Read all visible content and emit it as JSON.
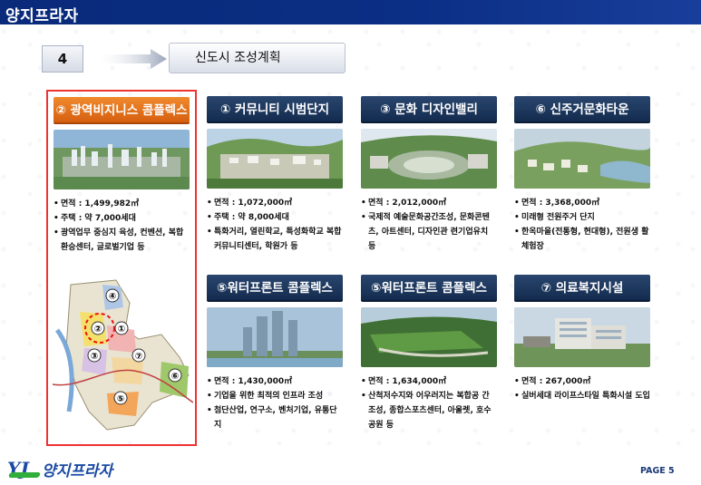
{
  "header": {
    "title": "양지프라자"
  },
  "section": {
    "number": "4",
    "title": "신도시 조성계획"
  },
  "featured": {
    "title": "② 광역비지니스 콤플렉스",
    "bullets": [
      "면적 : 1,499,982㎡",
      "주택 : 약 7,000세대",
      "광역업무 중심지 육성, 컨벤션, 복합환승센터, 글로벌기업 등"
    ],
    "map_labels": [
      "①",
      "②",
      "③",
      "④",
      "⑤",
      "⑥",
      "⑦"
    ]
  },
  "cards": [
    {
      "title": "① 커뮤니티 시범단지",
      "bullets": [
        "면적 : 1,072,000㎡",
        "주택 : 약 8,000세대",
        "특화거리, 열린학교, 특성화학교 복합커뮤니티센터, 학원가 등"
      ]
    },
    {
      "title": "③ 문화 디자인밸리",
      "bullets": [
        "면적 : 2,012,000㎡",
        "국제적 예술문화공간조성, 문화콘텐츠, 아트센터, 디자인관 련기업유치 등"
      ]
    },
    {
      "title": "⑥ 신주거문화타운",
      "bullets": [
        "면적 : 3,368,000㎡",
        "미래형 전원주거 단지",
        "한옥마을(전통형, 현대형), 전원생 활체험장"
      ]
    },
    {
      "title": "⑤워터프론트 콤플렉스",
      "bullets": [
        "면적 : 1,430,000㎡",
        "기업을 위한 최적의 인프라 조성",
        "첨단산업, 연구소, 벤처기업, 유통단지"
      ]
    },
    {
      "title": "⑤워터프론트 콤플렉스",
      "bullets": [
        "면적 : 1,634,000㎡",
        "산척저수지와 어우러지는 복합공 간 조성, 종합스포츠센터, 아울렛, 호수공원 등"
      ]
    },
    {
      "title": "⑦ 의료복지시설",
      "bullets": [
        "면적 : 267,000㎡",
        "실버세대 라이프스타일 특화시설 도입"
      ]
    }
  ],
  "footer": {
    "logo_mark": "YJ",
    "logo_text": "양지프라자",
    "page": "PAGE 5"
  }
}
